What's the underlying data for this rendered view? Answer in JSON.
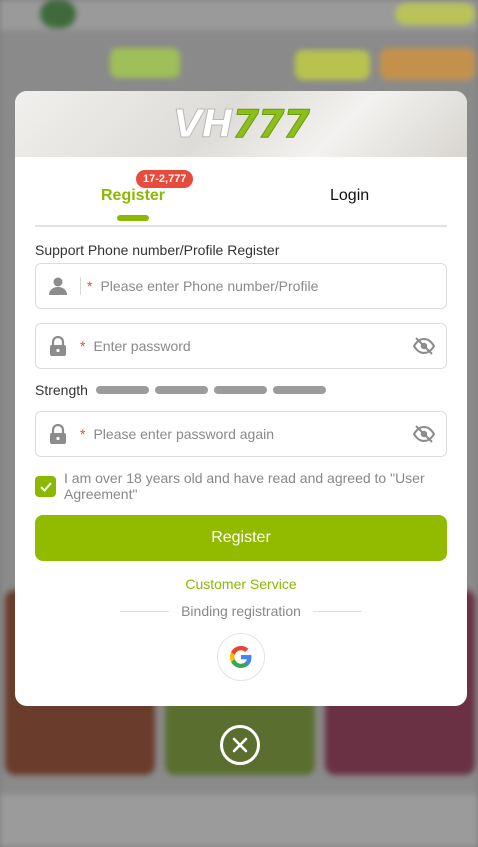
{
  "brand": {
    "logo_text_vh": "VH",
    "logo_text_num": "777"
  },
  "tabs": {
    "register_label": "Register",
    "login_label": "Login",
    "register_badge": "17-2,777"
  },
  "form": {
    "register_hint": "Support Phone number/Profile Register",
    "phone_placeholder": "Please enter Phone number/Profile",
    "password_placeholder": "Enter password",
    "confirm_placeholder": "Please enter password again",
    "required_mark": "*",
    "strength_label": "Strength",
    "agree_text": "I am over 18 years old and have read and agreed to \"User Agreement\"",
    "agree_checked": true,
    "submit_label": "Register"
  },
  "links": {
    "customer_service": "Customer Service",
    "binding_label": "Binding registration"
  },
  "social": {
    "google_icon": "google-icon"
  },
  "colors": {
    "accent": "#92bb00",
    "badge": "#e84a3b"
  }
}
